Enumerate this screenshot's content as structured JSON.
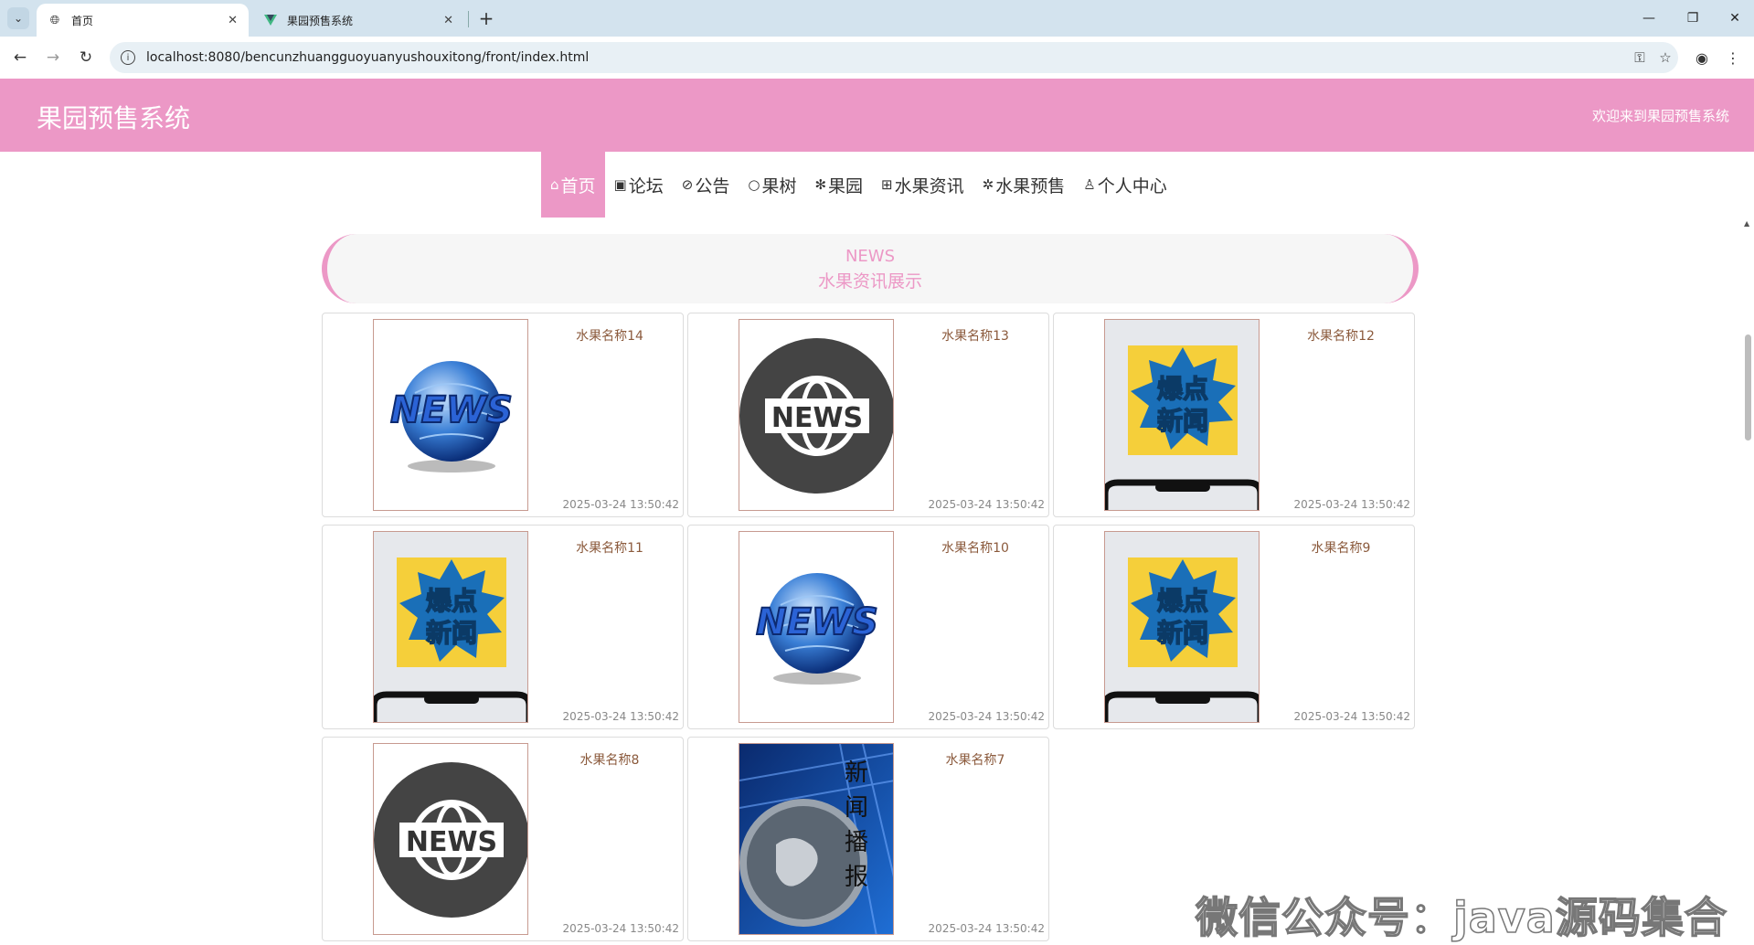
{
  "browser": {
    "tabs": [
      {
        "title": "首页",
        "active": true
      },
      {
        "title": "果园预售系统",
        "active": false
      }
    ],
    "url": "localhost:8080/bencunzhuangguoyuanyushouxitong/front/index.html"
  },
  "site": {
    "title": "果园预售系统",
    "welcome": "欢迎来到果园预售系统",
    "accent_color": "#ec98c6"
  },
  "nav": [
    {
      "icon": "⌂",
      "label": "首页",
      "active": true
    },
    {
      "icon": "▣",
      "label": "论坛",
      "active": false
    },
    {
      "icon": "⊘",
      "label": "公告",
      "active": false
    },
    {
      "icon": "○",
      "label": "果树",
      "active": false
    },
    {
      "icon": "✻",
      "label": "果园",
      "active": false
    },
    {
      "icon": "⊞",
      "label": "水果资讯",
      "active": false
    },
    {
      "icon": "✲",
      "label": "水果预售",
      "active": false
    },
    {
      "icon": "♙",
      "label": "个人中心",
      "active": false
    }
  ],
  "section": {
    "title_en": "NEWS",
    "title_cn": "水果资讯展示"
  },
  "news": [
    {
      "name": "水果名称14",
      "time": "2025-03-24 13:50:42",
      "image": "news-globe"
    },
    {
      "name": "水果名称13",
      "time": "2025-03-24 13:50:42",
      "image": "news-circle"
    },
    {
      "name": "水果名称12",
      "time": "2025-03-24 13:50:42",
      "image": "breaking-news"
    },
    {
      "name": "水果名称11",
      "time": "2025-03-24 13:50:42",
      "image": "breaking-news"
    },
    {
      "name": "水果名称10",
      "time": "2025-03-24 13:50:42",
      "image": "news-globe"
    },
    {
      "name": "水果名称9",
      "time": "2025-03-24 13:50:42",
      "image": "breaking-news"
    },
    {
      "name": "水果名称8",
      "time": "2025-03-24 13:50:42",
      "image": "news-circle"
    },
    {
      "name": "水果名称7",
      "time": "2025-03-24 13:50:42",
      "image": "news-broadcast"
    }
  ],
  "watermark": "微信公众号：java源码集合"
}
